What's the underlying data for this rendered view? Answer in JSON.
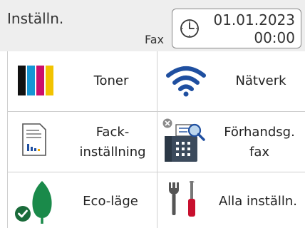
{
  "header": {
    "title": "Inställn.",
    "mode_label": "Fax",
    "date": "01.01.2023",
    "time": "00:00",
    "clock_icon": "clock-icon"
  },
  "tiles": [
    {
      "label": "Toner",
      "icon": "toner-icon"
    },
    {
      "label": "Nätverk",
      "icon": "wifi-icon"
    },
    {
      "label_line1": "Fack-",
      "label_line2": "inställning",
      "icon": "tray-settings-icon"
    },
    {
      "label_line1": "Förhandsg.",
      "label_line2": "fax",
      "icon": "fax-preview-icon"
    },
    {
      "label": "Eco-läge",
      "icon": "eco-leaf-icon"
    },
    {
      "label": "Alla inställn.",
      "icon": "tools-icon"
    }
  ],
  "colors": {
    "toner_black": "#111111",
    "toner_cyan": "#1596d4",
    "toner_magenta": "#cc0f6b",
    "toner_yellow": "#f2c300",
    "wifi_blue": "#1f4fa0",
    "eco_green": "#1a8a4a",
    "tool_red": "#c8102e"
  }
}
